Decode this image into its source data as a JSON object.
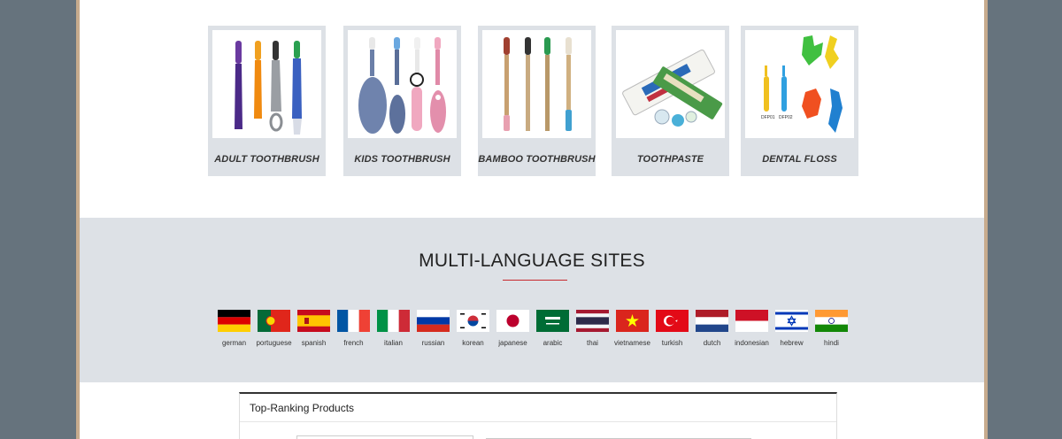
{
  "categories": [
    {
      "label": "ADULT TOOTHBRUSH",
      "icon": "adult-toothbrush-image"
    },
    {
      "label": "KIDS TOOTHBRUSH",
      "icon": "kids-toothbrush-image"
    },
    {
      "label": "BAMBOO TOOTHBRUSH",
      "icon": "bamboo-toothbrush-image"
    },
    {
      "label": "TOOTHPASTE",
      "icon": "toothpaste-image"
    },
    {
      "label": "DENTAL FLOSS",
      "icon": "dental-floss-image"
    }
  ],
  "multi_language": {
    "title": "MULTI-LANGUAGE SITES",
    "languages": [
      {
        "label": "german",
        "icon": "flag-germany-icon"
      },
      {
        "label": "portuguese",
        "icon": "flag-portugal-icon"
      },
      {
        "label": "spanish",
        "icon": "flag-spain-icon"
      },
      {
        "label": "french",
        "icon": "flag-france-icon"
      },
      {
        "label": "italian",
        "icon": "flag-italy-icon"
      },
      {
        "label": "russian",
        "icon": "flag-russia-icon"
      },
      {
        "label": "korean",
        "icon": "flag-korea-icon"
      },
      {
        "label": "japanese",
        "icon": "flag-japan-icon"
      },
      {
        "label": "arabic",
        "icon": "flag-saudi-arabia-icon"
      },
      {
        "label": "thai",
        "icon": "flag-thailand-icon"
      },
      {
        "label": "vietnamese",
        "icon": "flag-vietnam-icon"
      },
      {
        "label": "turkish",
        "icon": "flag-turkey-icon"
      },
      {
        "label": "dutch",
        "icon": "flag-netherlands-icon"
      },
      {
        "label": "indonesian",
        "icon": "flag-indonesia-icon"
      },
      {
        "label": "hebrew",
        "icon": "flag-israel-icon"
      },
      {
        "label": "hindi",
        "icon": "flag-india-icon"
      }
    ]
  },
  "top_ranking": {
    "title": "Top-Ranking Products"
  },
  "colors": {
    "accent": "#c8282e",
    "section_bg": "#dde1e6",
    "outer_bg": "#66737d",
    "frame_border": "#c7ab8d"
  }
}
